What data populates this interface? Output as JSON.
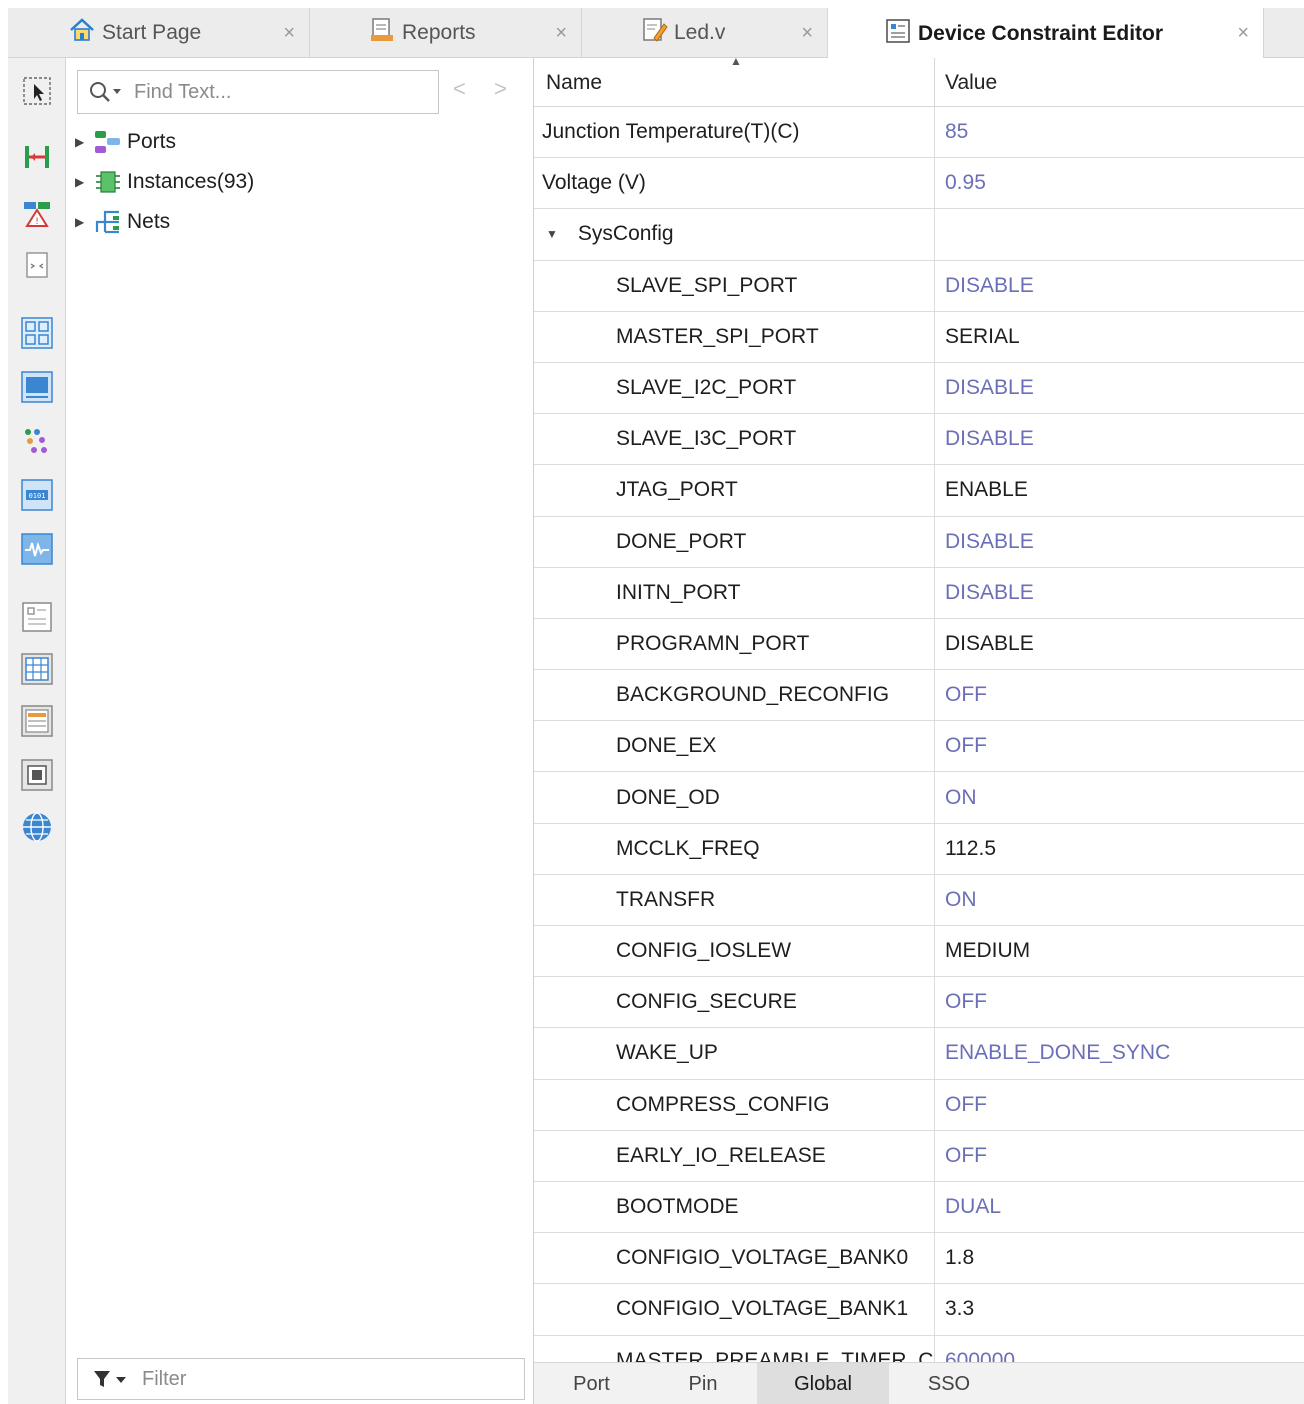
{
  "tabs": [
    {
      "label": "Start Page",
      "icon": "home-icon"
    },
    {
      "label": "Reports",
      "icon": "report-icon"
    },
    {
      "label": "Led.v",
      "icon": "verilog-file-icon"
    },
    {
      "label": "Device Constraint Editor",
      "icon": "constraint-editor-icon",
      "active": true
    }
  ],
  "search": {
    "placeholder": "Find Text..."
  },
  "filter": {
    "placeholder": "Filter"
  },
  "tree": [
    {
      "label": "Ports",
      "icon": "ports-icon"
    },
    {
      "label": "Instances(93)",
      "icon": "instances-icon"
    },
    {
      "label": "Nets",
      "icon": "nets-icon"
    }
  ],
  "grid": {
    "header": {
      "name": "Name",
      "value": "Value"
    },
    "rows": [
      {
        "name": "Junction Temperature(T)(C)",
        "value": "85",
        "indent": 0,
        "state": "default"
      },
      {
        "name": "Voltage (V)",
        "value": "0.95",
        "indent": 0,
        "state": "default"
      },
      {
        "name": "SysConfig",
        "value": "",
        "indent": 0,
        "group": true,
        "state": "set"
      },
      {
        "name": "SLAVE_SPI_PORT",
        "value": "DISABLE",
        "indent": 1,
        "state": "default"
      },
      {
        "name": "MASTER_SPI_PORT",
        "value": "SERIAL",
        "indent": 1,
        "state": "set"
      },
      {
        "name": "SLAVE_I2C_PORT",
        "value": "DISABLE",
        "indent": 1,
        "state": "default"
      },
      {
        "name": "SLAVE_I3C_PORT",
        "value": "DISABLE",
        "indent": 1,
        "state": "default"
      },
      {
        "name": "JTAG_PORT",
        "value": "ENABLE",
        "indent": 1,
        "state": "set"
      },
      {
        "name": "DONE_PORT",
        "value": "DISABLE",
        "indent": 1,
        "state": "default"
      },
      {
        "name": "INITN_PORT",
        "value": "DISABLE",
        "indent": 1,
        "state": "default"
      },
      {
        "name": "PROGRAMN_PORT",
        "value": "DISABLE",
        "indent": 1,
        "state": "set"
      },
      {
        "name": "BACKGROUND_RECONFIG",
        "value": "OFF",
        "indent": 1,
        "state": "default"
      },
      {
        "name": "DONE_EX",
        "value": "OFF",
        "indent": 1,
        "state": "default"
      },
      {
        "name": "DONE_OD",
        "value": "ON",
        "indent": 1,
        "state": "default"
      },
      {
        "name": "MCCLK_FREQ",
        "value": "112.5",
        "indent": 1,
        "state": "set"
      },
      {
        "name": "TRANSFR",
        "value": "ON",
        "indent": 1,
        "state": "default"
      },
      {
        "name": "CONFIG_IOSLEW",
        "value": "MEDIUM",
        "indent": 1,
        "state": "set"
      },
      {
        "name": "CONFIG_SECURE",
        "value": "OFF",
        "indent": 1,
        "state": "default"
      },
      {
        "name": "WAKE_UP",
        "value": "ENABLE_DONE_SYNC",
        "indent": 1,
        "state": "default"
      },
      {
        "name": "COMPRESS_CONFIG",
        "value": "OFF",
        "indent": 1,
        "state": "default"
      },
      {
        "name": "EARLY_IO_RELEASE",
        "value": "OFF",
        "indent": 1,
        "state": "default"
      },
      {
        "name": "BOOTMODE",
        "value": "DUAL",
        "indent": 1,
        "state": "default"
      },
      {
        "name": "CONFIGIO_VOLTAGE_BANK0",
        "value": "1.8",
        "indent": 1,
        "state": "set"
      },
      {
        "name": "CONFIGIO_VOLTAGE_BANK1",
        "value": "3.3",
        "indent": 1,
        "state": "set"
      },
      {
        "name": "MASTER_PREAMBLE_TIMER_C",
        "value": "600000",
        "indent": 1,
        "state": "default"
      }
    ]
  },
  "bottom_tabs": [
    {
      "label": "Port"
    },
    {
      "label": "Pin"
    },
    {
      "label": "Global",
      "active": true
    },
    {
      "label": "SSO"
    }
  ],
  "colors": {
    "default_value": "#6b6fb8",
    "set_value": "#1e1e1e",
    "accent": "#1e88e5"
  },
  "toolbar_icons": [
    "select-icon",
    "route-icon",
    "pin-planner-icon",
    "io-timing-icon",
    "floorplan-icon",
    "device-view-icon",
    "netlist-icon",
    "memory-icon",
    "waveform-icon",
    "properties-icon",
    "spreadsheet-icon",
    "report-table-icon",
    "chip-icon",
    "globe-icon"
  ]
}
